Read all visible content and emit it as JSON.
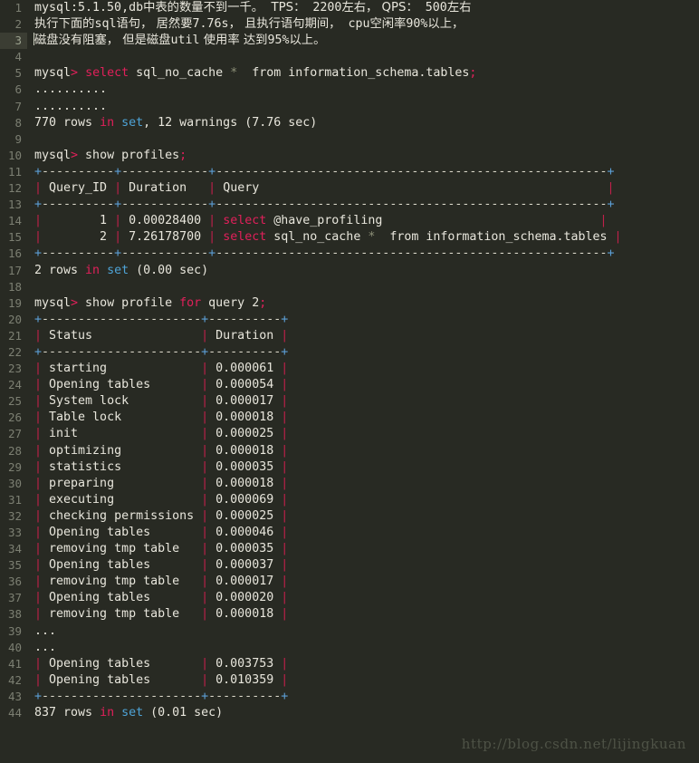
{
  "editor": {
    "background": "#282a23",
    "gutter_color": "#7c7f72",
    "current_line": 3,
    "total_lines": 44,
    "colors": {
      "keyword": "#e0205a",
      "function": "#4ea3d6",
      "pipe": "#c0204a",
      "plus": "#5c9fd6",
      "text": "#e8e6dc",
      "dim": "#8d9078"
    }
  },
  "watermark": {
    "text": "http://blog.csdn.net/lijingkuan"
  },
  "lines": [
    {
      "n": "1",
      "segments": [
        {
          "t": "mysql:5.1.50,db",
          "c": "txt"
        },
        {
          "t": "中表的数量不到一千。",
          "c": "cjk"
        },
        {
          "t": "  TPS：",
          "c": "cjk"
        },
        {
          "t": " 2200",
          "c": "txt"
        },
        {
          "t": "左右，",
          "c": "cjk"
        },
        {
          "t": " QPS：",
          "c": "cjk"
        },
        {
          "t": " 500",
          "c": "txt"
        },
        {
          "t": "左右",
          "c": "cjk"
        }
      ]
    },
    {
      "n": "2",
      "segments": [
        {
          "t": "执行下面的",
          "c": "cjk"
        },
        {
          "t": "sql",
          "c": "txt"
        },
        {
          "t": "语句，",
          "c": "cjk"
        },
        {
          "t": " 居然要",
          "c": "cjk"
        },
        {
          "t": "7.76s",
          "c": "txt"
        },
        {
          "t": "，",
          "c": "cjk"
        },
        {
          "t": " 且执行语句期间，",
          "c": "cjk"
        },
        {
          "t": " cpu",
          "c": "txt"
        },
        {
          "t": "空闲率",
          "c": "cjk"
        },
        {
          "t": "90%",
          "c": "txt"
        },
        {
          "t": "以上，",
          "c": "cjk"
        }
      ]
    },
    {
      "n": "3",
      "segments": [
        {
          "t": "磁盘没有阻塞，",
          "c": "cjk"
        },
        {
          "t": " 但是磁盘",
          "c": "cjk"
        },
        {
          "t": "util",
          "c": "txt"
        },
        {
          "t": " 使用率",
          "c": "cjk"
        },
        {
          "t": " 达到",
          "c": "cjk"
        },
        {
          "t": "95%",
          "c": "txt"
        },
        {
          "t": "以上。",
          "c": "cjk"
        }
      ]
    },
    {
      "n": "4",
      "segments": []
    },
    {
      "n": "5",
      "segments": [
        {
          "t": "mysql",
          "c": "txt"
        },
        {
          "t": ">",
          "c": "kw"
        },
        {
          "t": " ",
          "c": "txt"
        },
        {
          "t": "select",
          "c": "kw"
        },
        {
          "t": " sql_no_cache ",
          "c": "txt"
        },
        {
          "t": "*",
          "c": "dim"
        },
        {
          "t": "  from information_schema.tables",
          "c": "txt"
        },
        {
          "t": ";",
          "c": "kw"
        }
      ]
    },
    {
      "n": "6",
      "segments": [
        {
          "t": "..........",
          "c": "txt"
        }
      ]
    },
    {
      "n": "7",
      "segments": [
        {
          "t": "..........",
          "c": "txt"
        }
      ]
    },
    {
      "n": "8",
      "segments": [
        {
          "t": "770 rows ",
          "c": "txt"
        },
        {
          "t": "in",
          "c": "kw"
        },
        {
          "t": " ",
          "c": "txt"
        },
        {
          "t": "set",
          "c": "fn"
        },
        {
          "t": ", 12 warnings (7.76 sec)",
          "c": "txt"
        }
      ]
    },
    {
      "n": "9",
      "segments": []
    },
    {
      "n": "10",
      "segments": [
        {
          "t": "mysql",
          "c": "txt"
        },
        {
          "t": ">",
          "c": "kw"
        },
        {
          "t": " show profiles",
          "c": "txt"
        },
        {
          "t": ";",
          "c": "kw"
        }
      ]
    },
    {
      "n": "11",
      "segments": [
        {
          "t": "+",
          "c": "plus"
        },
        {
          "t": "----------",
          "c": "rule"
        },
        {
          "t": "+",
          "c": "plus"
        },
        {
          "t": "------------",
          "c": "rule"
        },
        {
          "t": "+",
          "c": "plus"
        },
        {
          "t": "------------------------------------------------------",
          "c": "rule"
        },
        {
          "t": "+",
          "c": "plus"
        }
      ]
    },
    {
      "n": "12",
      "segments": [
        {
          "t": "|",
          "c": "pipe"
        },
        {
          "t": " Query_ID ",
          "c": "txt"
        },
        {
          "t": "|",
          "c": "pipe"
        },
        {
          "t": " Duration   ",
          "c": "txt"
        },
        {
          "t": "|",
          "c": "pipe"
        },
        {
          "t": " Query                                                ",
          "c": "txt"
        },
        {
          "t": "|",
          "c": "pipe"
        }
      ]
    },
    {
      "n": "13",
      "segments": [
        {
          "t": "+",
          "c": "plus"
        },
        {
          "t": "----------",
          "c": "rule"
        },
        {
          "t": "+",
          "c": "plus"
        },
        {
          "t": "------------",
          "c": "rule"
        },
        {
          "t": "+",
          "c": "plus"
        },
        {
          "t": "------------------------------------------------------",
          "c": "rule"
        },
        {
          "t": "+",
          "c": "plus"
        }
      ]
    },
    {
      "n": "14",
      "segments": [
        {
          "t": "|",
          "c": "pipe"
        },
        {
          "t": "        1 ",
          "c": "txt"
        },
        {
          "t": "|",
          "c": "pipe"
        },
        {
          "t": " 0.00028400 ",
          "c": "txt"
        },
        {
          "t": "|",
          "c": "pipe"
        },
        {
          "t": " ",
          "c": "txt"
        },
        {
          "t": "select",
          "c": "kw"
        },
        {
          "t": " @have_profiling                              ",
          "c": "txt"
        },
        {
          "t": "|",
          "c": "pipe"
        }
      ]
    },
    {
      "n": "15",
      "segments": [
        {
          "t": "|",
          "c": "pipe"
        },
        {
          "t": "        2 ",
          "c": "txt"
        },
        {
          "t": "|",
          "c": "pipe"
        },
        {
          "t": " 7.26178700 ",
          "c": "txt"
        },
        {
          "t": "|",
          "c": "pipe"
        },
        {
          "t": " ",
          "c": "txt"
        },
        {
          "t": "select",
          "c": "kw"
        },
        {
          "t": " sql_no_cache ",
          "c": "txt"
        },
        {
          "t": "*",
          "c": "dim"
        },
        {
          "t": "  from information_schema.tables ",
          "c": "txt"
        },
        {
          "t": "|",
          "c": "pipe"
        }
      ]
    },
    {
      "n": "16",
      "segments": [
        {
          "t": "+",
          "c": "plus"
        },
        {
          "t": "----------",
          "c": "rule"
        },
        {
          "t": "+",
          "c": "plus"
        },
        {
          "t": "------------",
          "c": "rule"
        },
        {
          "t": "+",
          "c": "plus"
        },
        {
          "t": "------------------------------------------------------",
          "c": "rule"
        },
        {
          "t": "+",
          "c": "plus"
        }
      ]
    },
    {
      "n": "17",
      "segments": [
        {
          "t": "2 rows ",
          "c": "txt"
        },
        {
          "t": "in",
          "c": "kw"
        },
        {
          "t": " ",
          "c": "txt"
        },
        {
          "t": "set",
          "c": "fn"
        },
        {
          "t": " (0.00 sec)",
          "c": "txt"
        }
      ]
    },
    {
      "n": "18",
      "segments": []
    },
    {
      "n": "19",
      "segments": [
        {
          "t": "mysql",
          "c": "txt"
        },
        {
          "t": ">",
          "c": "kw"
        },
        {
          "t": " show profile ",
          "c": "txt"
        },
        {
          "t": "for",
          "c": "kw"
        },
        {
          "t": " query 2",
          "c": "txt"
        },
        {
          "t": ";",
          "c": "kw"
        }
      ]
    },
    {
      "n": "20",
      "segments": [
        {
          "t": "+",
          "c": "plus"
        },
        {
          "t": "----------------------",
          "c": "rule"
        },
        {
          "t": "+",
          "c": "plus"
        },
        {
          "t": "----------",
          "c": "rule"
        },
        {
          "t": "+",
          "c": "plus"
        }
      ]
    },
    {
      "n": "21",
      "segments": [
        {
          "t": "|",
          "c": "pipe"
        },
        {
          "t": " Status               ",
          "c": "txt"
        },
        {
          "t": "|",
          "c": "pipe"
        },
        {
          "t": " Duration ",
          "c": "txt"
        },
        {
          "t": "|",
          "c": "pipe"
        }
      ]
    },
    {
      "n": "22",
      "segments": [
        {
          "t": "+",
          "c": "plus"
        },
        {
          "t": "----------------------",
          "c": "rule"
        },
        {
          "t": "+",
          "c": "plus"
        },
        {
          "t": "----------",
          "c": "rule"
        },
        {
          "t": "+",
          "c": "plus"
        }
      ]
    },
    {
      "n": "23",
      "segments": [
        {
          "t": "|",
          "c": "pipe"
        },
        {
          "t": " starting             ",
          "c": "txt"
        },
        {
          "t": "|",
          "c": "pipe"
        },
        {
          "t": " 0.000061 ",
          "c": "txt"
        },
        {
          "t": "|",
          "c": "pipe"
        }
      ]
    },
    {
      "n": "24",
      "segments": [
        {
          "t": "|",
          "c": "pipe"
        },
        {
          "t": " Opening tables       ",
          "c": "txt"
        },
        {
          "t": "|",
          "c": "pipe"
        },
        {
          "t": " 0.000054 ",
          "c": "txt"
        },
        {
          "t": "|",
          "c": "pipe"
        }
      ]
    },
    {
      "n": "25",
      "segments": [
        {
          "t": "|",
          "c": "pipe"
        },
        {
          "t": " System lock          ",
          "c": "txt"
        },
        {
          "t": "|",
          "c": "pipe"
        },
        {
          "t": " 0.000017 ",
          "c": "txt"
        },
        {
          "t": "|",
          "c": "pipe"
        }
      ]
    },
    {
      "n": "26",
      "segments": [
        {
          "t": "|",
          "c": "pipe"
        },
        {
          "t": " Table lock           ",
          "c": "txt"
        },
        {
          "t": "|",
          "c": "pipe"
        },
        {
          "t": " 0.000018 ",
          "c": "txt"
        },
        {
          "t": "|",
          "c": "pipe"
        }
      ]
    },
    {
      "n": "27",
      "segments": [
        {
          "t": "|",
          "c": "pipe"
        },
        {
          "t": " init                 ",
          "c": "txt"
        },
        {
          "t": "|",
          "c": "pipe"
        },
        {
          "t": " 0.000025 ",
          "c": "txt"
        },
        {
          "t": "|",
          "c": "pipe"
        }
      ]
    },
    {
      "n": "28",
      "segments": [
        {
          "t": "|",
          "c": "pipe"
        },
        {
          "t": " optimizing           ",
          "c": "txt"
        },
        {
          "t": "|",
          "c": "pipe"
        },
        {
          "t": " 0.000018 ",
          "c": "txt"
        },
        {
          "t": "|",
          "c": "pipe"
        }
      ]
    },
    {
      "n": "29",
      "segments": [
        {
          "t": "|",
          "c": "pipe"
        },
        {
          "t": " statistics           ",
          "c": "txt"
        },
        {
          "t": "|",
          "c": "pipe"
        },
        {
          "t": " 0.000035 ",
          "c": "txt"
        },
        {
          "t": "|",
          "c": "pipe"
        }
      ]
    },
    {
      "n": "30",
      "segments": [
        {
          "t": "|",
          "c": "pipe"
        },
        {
          "t": " preparing            ",
          "c": "txt"
        },
        {
          "t": "|",
          "c": "pipe"
        },
        {
          "t": " 0.000018 ",
          "c": "txt"
        },
        {
          "t": "|",
          "c": "pipe"
        }
      ]
    },
    {
      "n": "31",
      "segments": [
        {
          "t": "|",
          "c": "pipe"
        },
        {
          "t": " executing            ",
          "c": "txt"
        },
        {
          "t": "|",
          "c": "pipe"
        },
        {
          "t": " 0.000069 ",
          "c": "txt"
        },
        {
          "t": "|",
          "c": "pipe"
        }
      ]
    },
    {
      "n": "32",
      "segments": [
        {
          "t": "|",
          "c": "pipe"
        },
        {
          "t": " checking permissions ",
          "c": "txt"
        },
        {
          "t": "|",
          "c": "pipe"
        },
        {
          "t": " 0.000025 ",
          "c": "txt"
        },
        {
          "t": "|",
          "c": "pipe"
        }
      ]
    },
    {
      "n": "33",
      "segments": [
        {
          "t": "|",
          "c": "pipe"
        },
        {
          "t": " Opening tables       ",
          "c": "txt"
        },
        {
          "t": "|",
          "c": "pipe"
        },
        {
          "t": " 0.000046 ",
          "c": "txt"
        },
        {
          "t": "|",
          "c": "pipe"
        }
      ]
    },
    {
      "n": "34",
      "segments": [
        {
          "t": "|",
          "c": "pipe"
        },
        {
          "t": " removing tmp table   ",
          "c": "txt"
        },
        {
          "t": "|",
          "c": "pipe"
        },
        {
          "t": " 0.000035 ",
          "c": "txt"
        },
        {
          "t": "|",
          "c": "pipe"
        }
      ]
    },
    {
      "n": "35",
      "segments": [
        {
          "t": "|",
          "c": "pipe"
        },
        {
          "t": " Opening tables       ",
          "c": "txt"
        },
        {
          "t": "|",
          "c": "pipe"
        },
        {
          "t": " 0.000037 ",
          "c": "txt"
        },
        {
          "t": "|",
          "c": "pipe"
        }
      ]
    },
    {
      "n": "36",
      "segments": [
        {
          "t": "|",
          "c": "pipe"
        },
        {
          "t": " removing tmp table   ",
          "c": "txt"
        },
        {
          "t": "|",
          "c": "pipe"
        },
        {
          "t": " 0.000017 ",
          "c": "txt"
        },
        {
          "t": "|",
          "c": "pipe"
        }
      ]
    },
    {
      "n": "37",
      "segments": [
        {
          "t": "|",
          "c": "pipe"
        },
        {
          "t": " Opening tables       ",
          "c": "txt"
        },
        {
          "t": "|",
          "c": "pipe"
        },
        {
          "t": " 0.000020 ",
          "c": "txt"
        },
        {
          "t": "|",
          "c": "pipe"
        }
      ]
    },
    {
      "n": "38",
      "segments": [
        {
          "t": "|",
          "c": "pipe"
        },
        {
          "t": " removing tmp table   ",
          "c": "txt"
        },
        {
          "t": "|",
          "c": "pipe"
        },
        {
          "t": " 0.000018 ",
          "c": "txt"
        },
        {
          "t": "|",
          "c": "pipe"
        }
      ]
    },
    {
      "n": "39",
      "segments": [
        {
          "t": "...",
          "c": "txt"
        }
      ]
    },
    {
      "n": "40",
      "segments": [
        {
          "t": "...",
          "c": "txt"
        }
      ]
    },
    {
      "n": "41",
      "segments": [
        {
          "t": "|",
          "c": "pipe"
        },
        {
          "t": " Opening tables       ",
          "c": "txt"
        },
        {
          "t": "|",
          "c": "pipe"
        },
        {
          "t": " 0.003753 ",
          "c": "txt"
        },
        {
          "t": "|",
          "c": "pipe"
        }
      ]
    },
    {
      "n": "42",
      "segments": [
        {
          "t": "|",
          "c": "pipe"
        },
        {
          "t": " Opening tables       ",
          "c": "txt"
        },
        {
          "t": "|",
          "c": "pipe"
        },
        {
          "t": " 0.010359 ",
          "c": "txt"
        },
        {
          "t": "|",
          "c": "pipe"
        }
      ]
    },
    {
      "n": "43",
      "segments": [
        {
          "t": "+",
          "c": "plus"
        },
        {
          "t": "----------------------",
          "c": "rule"
        },
        {
          "t": "+",
          "c": "plus"
        },
        {
          "t": "----------",
          "c": "rule"
        },
        {
          "t": "+",
          "c": "plus"
        }
      ]
    },
    {
      "n": "44",
      "segments": [
        {
          "t": "837 rows ",
          "c": "txt"
        },
        {
          "t": "in",
          "c": "kw"
        },
        {
          "t": " ",
          "c": "txt"
        },
        {
          "t": "set",
          "c": "fn"
        },
        {
          "t": " (0.01 sec)",
          "c": "txt"
        }
      ]
    }
  ]
}
